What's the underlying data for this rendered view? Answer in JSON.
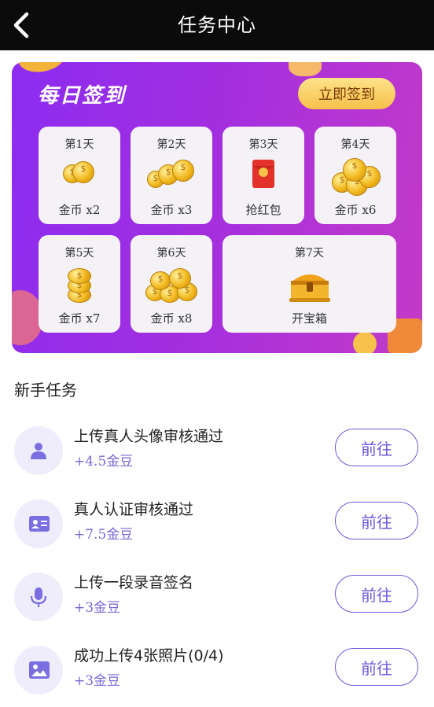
{
  "header": {
    "title": "任务中心"
  },
  "checkin": {
    "title": "每日签到",
    "button_label": "立即签到",
    "days": [
      {
        "day": "第1天",
        "reward": "金币 x2",
        "icon": "coins-icon"
      },
      {
        "day": "第2天",
        "reward": "金币 x3",
        "icon": "coins-icon"
      },
      {
        "day": "第3天",
        "reward": "抢红包",
        "icon": "red-envelope-icon"
      },
      {
        "day": "第4天",
        "reward": "金币 x6",
        "icon": "coins-icon"
      },
      {
        "day": "第5天",
        "reward": "金币 x7",
        "icon": "coins-icon"
      },
      {
        "day": "第6天",
        "reward": "金币 x8",
        "icon": "coins-icon"
      },
      {
        "day": "第7天",
        "reward": "开宝箱",
        "icon": "treasure-chest-icon"
      }
    ]
  },
  "newbie": {
    "title": "新手任务",
    "tasks": [
      {
        "name": "上传真人头像审核通过",
        "reward": "+4.5金豆",
        "button": "前往",
        "icon": "user-icon"
      },
      {
        "name": "真人认证审核通过",
        "reward": "+7.5金豆",
        "button": "前往",
        "icon": "id-card-icon"
      },
      {
        "name": "上传一段录音签名",
        "reward": "+3金豆",
        "button": "前往",
        "icon": "microphone-icon"
      },
      {
        "name": "成功上传4张照片(0/4)",
        "reward": "+3金豆",
        "button": "前往",
        "icon": "image-icon"
      }
    ]
  },
  "colors": {
    "header_bg": "#0b0b0b",
    "panel_start": "#8c2cf0",
    "panel_end": "#c43ac8",
    "accent": "#6c58d9",
    "reward_text": "#7a67d6",
    "checkin_button": "#f6c04a"
  }
}
